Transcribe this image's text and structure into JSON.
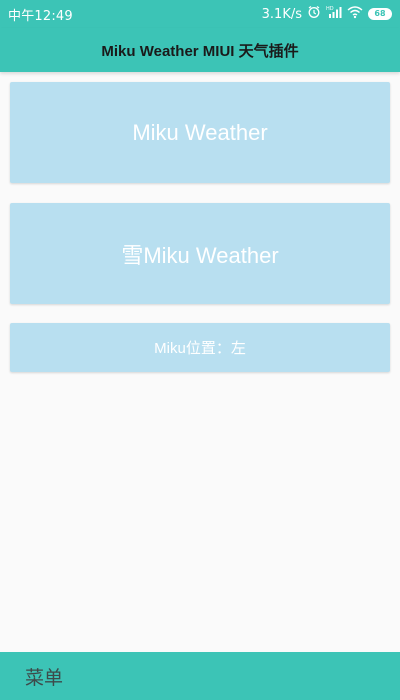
{
  "status_bar": {
    "time": "中午12:49",
    "network_speed": "3.1K/s",
    "battery_level": "68",
    "icons": [
      "alarm-icon",
      "signal-icon",
      "wifi-icon",
      "battery-icon"
    ]
  },
  "app_bar": {
    "title": "Miku Weather MIUI 天气插件"
  },
  "cards": [
    {
      "label": "Miku Weather"
    },
    {
      "label": "雪Miku Weather"
    },
    {
      "label": "Miku位置：左"
    }
  ],
  "bottom_bar": {
    "menu_label": "菜单"
  },
  "colors": {
    "accent": "#3cc4b6",
    "card_bg": "#b8dff0",
    "page_bg": "#fafafa"
  }
}
